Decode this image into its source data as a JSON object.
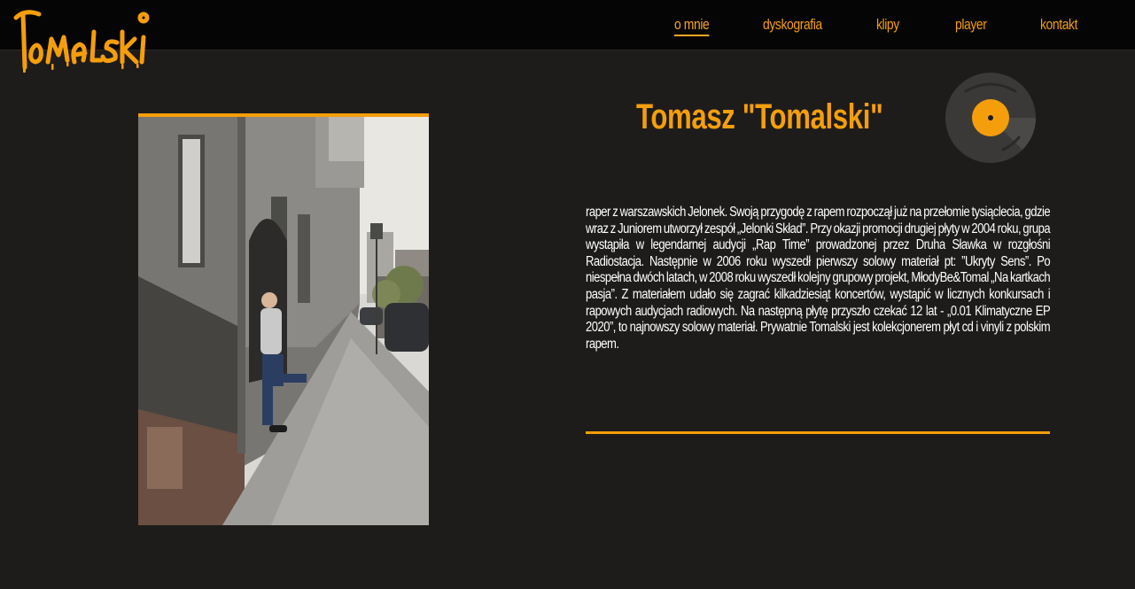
{
  "header": {
    "logo_text": "Tomalski",
    "nav": [
      {
        "label": "o mnie",
        "active": true
      },
      {
        "label": "dyskografia",
        "active": false
      },
      {
        "label": "klipy",
        "active": false
      },
      {
        "label": "player",
        "active": false
      },
      {
        "label": "kontakt",
        "active": false
      }
    ]
  },
  "about": {
    "title": "Tomasz \"Tomalski\"",
    "bio": "raper z warszawskich Jelonek. Swoją przygodę z rapem rozpoczął już na przełomie tysiąclecia, gdzie wraz z Juniorem utworzył zespół „Jelonki Skład”. Przy okazji promocji drugiej płyty w 2004 roku, grupa wystąpiła w legendarnej audycji „Rap Time” prowadzonej przez Druha Sławka w rozgłośni Radiostacja. Następnie w 2006 roku wyszedł pierwszy solowy materiał pt: ”Ukryty Sens”. Po niespełna dwóch latach, w 2008 roku wyszedł kolejny grupowy projekt, MłodyBe&Tomal „Na kartkach pasja”. Z materiałem udało się zagrać kilkadziesiąt koncertów, wystąpić w licznych konkursach i rapowych audycjach radiowych. Na następną płytę przyszło czekać 12 lat - „0.01 Klimatyczne EP 2020”, to najnowszy solowy materiał. Prywatnie Tomalski jest kolekcjonerem płyt cd i vinyli z polskim rapem."
  },
  "colors": {
    "accent": "#f59e0b",
    "background": "#1d1c1b",
    "topbar": "#050505",
    "text": "#ffffff"
  },
  "icons": {
    "logo": "tomalski-graffiti-logo",
    "vinyl": "vinyl-record-icon"
  }
}
